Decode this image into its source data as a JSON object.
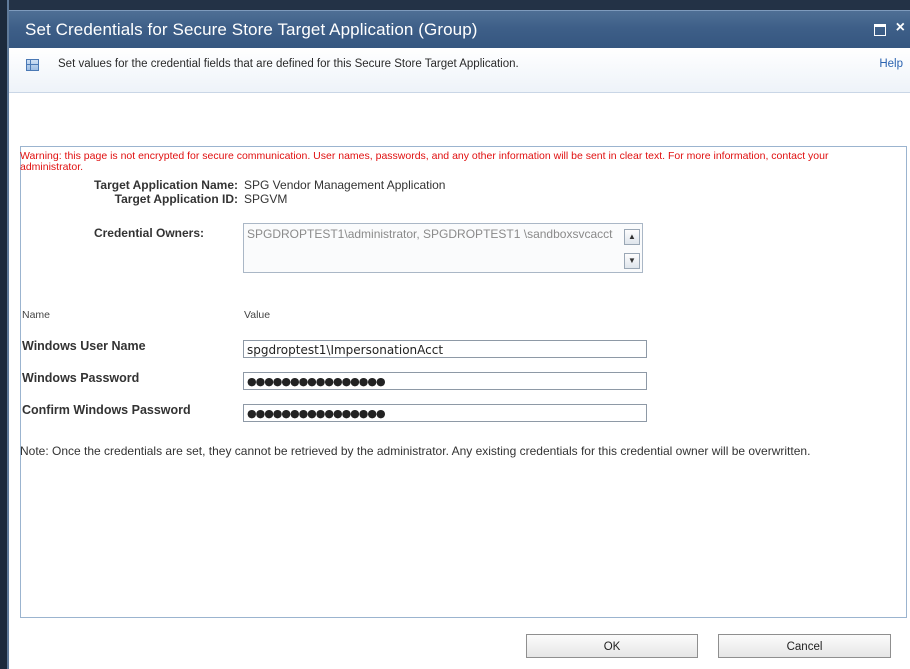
{
  "dialog": {
    "title": "Set Credentials for Secure Store Target Application (Group)",
    "max_glyph": "",
    "close_glyph": "×"
  },
  "infobar": {
    "description": "Set values for the credential fields that are defined for this Secure Store Target Application.",
    "help_label": "Help"
  },
  "warning": "Warning: this page is not encrypted for secure communication. User names, passwords, and any other information will be sent in clear text. For more information, contact your administrator.",
  "target": {
    "name_label": "Target Application Name:",
    "name_value": "SPG Vendor Management Application",
    "id_label": "Target Application ID:",
    "id_value": "SPGVM"
  },
  "owners": {
    "label": "Credential Owners:",
    "value": "SPGDROPTEST1\\administrator, SPGDROPTEST1 \\sandboxsvcacct",
    "scroll_up": "▲",
    "scroll_down": "▼"
  },
  "columns": {
    "name": "Name",
    "value": "Value"
  },
  "fields": {
    "username_label": "Windows User Name",
    "username_value": "spgdroptest1\\ImpersonationAcct",
    "password_label": "Windows Password",
    "password_value": "●●●●●●●●●●●●●●●●",
    "confirm_label": "Confirm Windows Password",
    "confirm_value": "●●●●●●●●●●●●●●●●"
  },
  "note": "Note: Once the credentials are set, they cannot be retrieved by the administrator. Any existing credentials for this credential owner will be overwritten.",
  "buttons": {
    "ok": "OK",
    "cancel": "Cancel"
  },
  "colors": {
    "titlebar": "#3e5f88",
    "warning": "#e01010",
    "link": "#2a63b0"
  },
  "icons": {
    "info": "table-icon",
    "maximize": "maximize-icon",
    "close": "close-icon"
  }
}
